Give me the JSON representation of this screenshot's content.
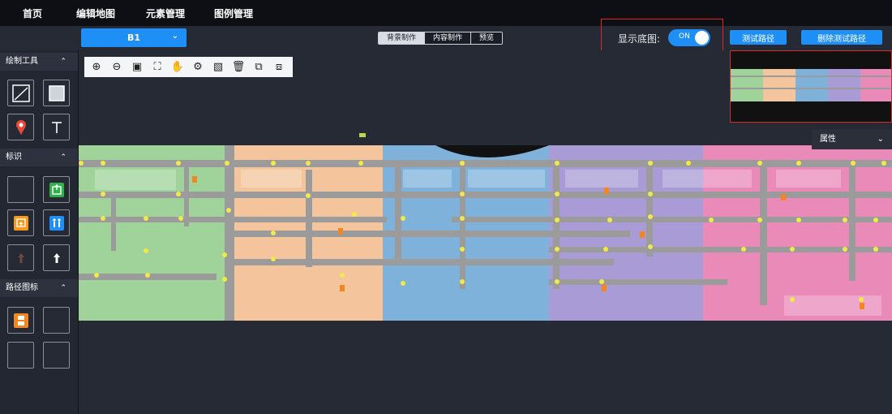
{
  "nav": {
    "items": [
      "首页",
      "编辑地图",
      "元素管理",
      "图例管理"
    ]
  },
  "floor": {
    "value": "B1"
  },
  "modes": {
    "items": [
      "背景制作",
      "内容制作",
      "预览"
    ],
    "active": 0
  },
  "basemap": {
    "label": "显示底图:",
    "toggle_text": "ON"
  },
  "buttons": {
    "test_route": "测试路径",
    "delete_test_route": "删除测试路径"
  },
  "sidebar": {
    "draw_tools": "绘制工具",
    "marks": "标识",
    "route_icons": "路径图标"
  },
  "panel": {
    "properties": "属性"
  },
  "map_toolbar_icons": [
    "zoom-in-icon",
    "zoom-out-icon",
    "fit-icon",
    "fullscreen-icon",
    "hand-icon",
    "settings-icon",
    "save-icon",
    "delete-icon",
    "copy-delete-icon",
    "copy-icon"
  ],
  "colors": {
    "accent": "#1e8ff6",
    "highlight": "#e0242a",
    "zone_green": "#9fd39a",
    "zone_orange": "#f4c59c",
    "zone_blue": "#7fb2db",
    "zone_purple": "#a99bd6",
    "zone_pink": "#e98ab9"
  }
}
